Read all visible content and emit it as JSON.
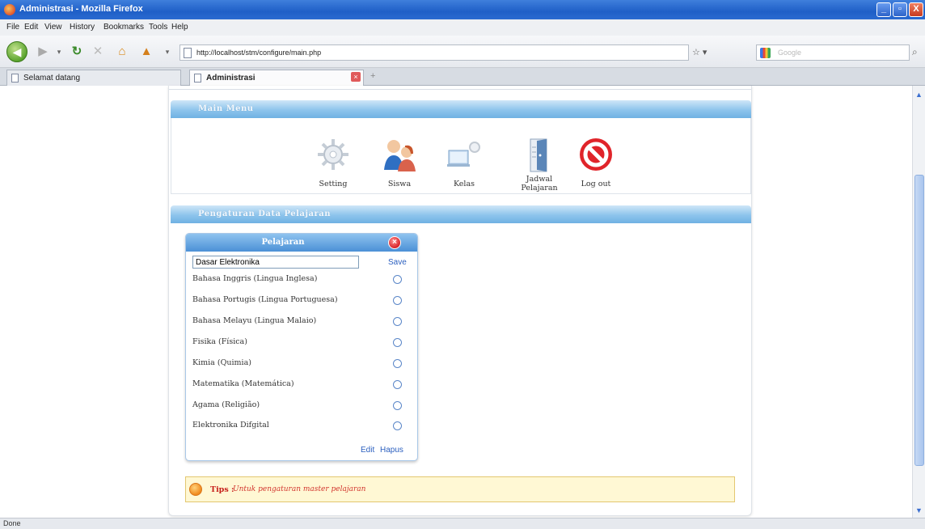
{
  "window": {
    "title": "Administrasi - Mozilla Firefox",
    "buttons": {
      "minimize": "_",
      "maximize": "▫",
      "close": "X"
    }
  },
  "menubar": [
    "File",
    "Edit",
    "View",
    "History",
    "Bookmarks",
    "Tools",
    "Help"
  ],
  "navbar": {
    "url": "http://localhost/stm/configure/main.php",
    "search_placeholder": "Google"
  },
  "tabs": [
    {
      "label": "Selamat datang",
      "active": false
    },
    {
      "label": "Administrasi",
      "active": true
    }
  ],
  "main_menu": {
    "header": "Main Menu",
    "items": [
      {
        "label": "Setting",
        "icon": "gear-icon"
      },
      {
        "label": "Siswa",
        "icon": "students-icon"
      },
      {
        "label": "Kelas",
        "icon": "classroom-icon"
      },
      {
        "label": "Jadwal Pelajaran",
        "icon": "schedule-door-icon"
      },
      {
        "label": "Log out",
        "icon": "logout-icon"
      }
    ]
  },
  "section": {
    "header": "Pengaturan Data Pelajaran"
  },
  "pelajaran": {
    "title": "Pelajaran",
    "edit_value": "Dasar Elektronika",
    "save_label": "Save",
    "subjects": [
      "Bahasa Inggris (Lingua Inglesa)",
      "Bahasa Portugis (Lingua Portuguesa)",
      "Bahasa Melayu (Lingua Malaio)",
      "Fisika (Física)",
      "Kimia (Quimia)",
      "Matematika (Matemática)",
      "Agama (Religião)",
      "Elektronika Difgital"
    ],
    "edit_label": "Edit",
    "delete_label": "Hapus"
  },
  "tips": {
    "label": "Tips :",
    "text": "Untuk pengaturan master pelajaran"
  },
  "status": "Done"
}
